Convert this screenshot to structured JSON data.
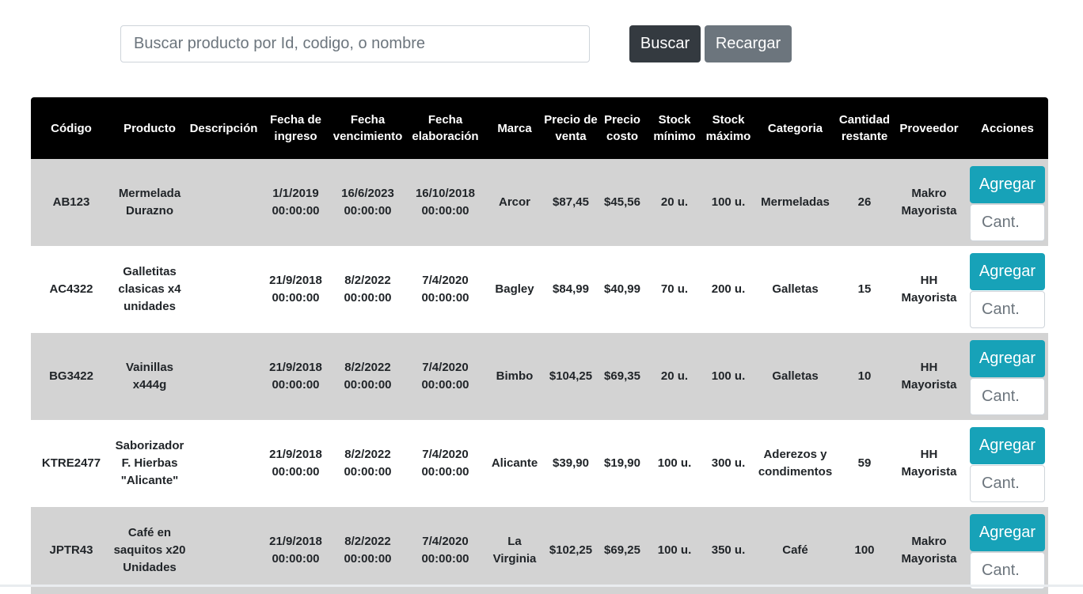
{
  "search": {
    "placeholder": "Buscar producto por Id, codigo, o nombre",
    "buscar_label": "Buscar",
    "recargar_label": "Recargar"
  },
  "table": {
    "headers": [
      "Código",
      "Producto",
      "Descripción",
      "Fecha de ingreso",
      "Fecha vencimiento",
      "Fecha elaboración",
      "Marca",
      "Precio de venta",
      "Precio costo",
      "Stock mínimo",
      "Stock máximo",
      "Categoria",
      "Cantidad restante",
      "Proveedor",
      "Acciones"
    ],
    "rows": [
      {
        "codigo": "AB123",
        "producto": "Mermelada Durazno",
        "descripcion": "",
        "ingreso": "1/1/2019 00:00:00",
        "vencimiento": "16/6/2023 00:00:00",
        "elaboracion": "16/10/2018 00:00:00",
        "marca": "Arcor",
        "precio_venta": "$87,45",
        "precio_costo": "$45,56",
        "stock_min": "20 u.",
        "stock_max": "100 u.",
        "categoria": "Mermeladas",
        "cantidad": "26",
        "proveedor": "Makro Mayorista",
        "agregar": "Agregar",
        "cant_placeholder": "Cant."
      },
      {
        "codigo": "AC4322",
        "producto": "Galletitas clasicas x4 unidades",
        "descripcion": "",
        "ingreso": "21/9/2018 00:00:00",
        "vencimiento": "8/2/2022 00:00:00",
        "elaboracion": "7/4/2020 00:00:00",
        "marca": "Bagley",
        "precio_venta": "$84,99",
        "precio_costo": "$40,99",
        "stock_min": "70 u.",
        "stock_max": "200 u.",
        "categoria": "Galletas",
        "cantidad": "15",
        "proveedor": "HH Mayorista",
        "agregar": "Agregar",
        "cant_placeholder": "Cant."
      },
      {
        "codigo": "BG3422",
        "producto": "Vainillas x444g",
        "descripcion": "",
        "ingreso": "21/9/2018 00:00:00",
        "vencimiento": "8/2/2022 00:00:00",
        "elaboracion": "7/4/2020 00:00:00",
        "marca": "Bimbo",
        "precio_venta": "$104,25",
        "precio_costo": "$69,35",
        "stock_min": "20 u.",
        "stock_max": "100 u.",
        "categoria": "Galletas",
        "cantidad": "10",
        "proveedor": "HH Mayorista",
        "agregar": "Agregar",
        "cant_placeholder": "Cant."
      },
      {
        "codigo": "KTRE2477",
        "producto": "Saborizador F. Hierbas \"Alicante\"",
        "descripcion": "",
        "ingreso": "21/9/2018 00:00:00",
        "vencimiento": "8/2/2022 00:00:00",
        "elaboracion": "7/4/2020 00:00:00",
        "marca": "Alicante",
        "precio_venta": "$39,90",
        "precio_costo": "$19,90",
        "stock_min": "100 u.",
        "stock_max": "300 u.",
        "categoria": "Aderezos y condimentos",
        "cantidad": "59",
        "proveedor": "HH Mayorista",
        "agregar": "Agregar",
        "cant_placeholder": "Cant."
      },
      {
        "codigo": "JPTR43",
        "producto": "Café en saquitos x20 Unidades",
        "descripcion": "",
        "ingreso": "21/9/2018 00:00:00",
        "vencimiento": "8/2/2022 00:00:00",
        "elaboracion": "7/4/2020 00:00:00",
        "marca": "La Virginia",
        "precio_venta": "$102,25",
        "precio_costo": "$69,25",
        "stock_min": "100 u.",
        "stock_max": "350 u.",
        "categoria": "Café",
        "cantidad": "100",
        "proveedor": "Makro Mayorista",
        "agregar": "Agregar",
        "cant_placeholder": "Cant."
      }
    ]
  },
  "colors": {
    "buscar_bg": "#343a40",
    "recargar_bg": "#6c757d",
    "agregar_bg": "#17a2b8",
    "header_bg": "#000000",
    "row_odd_bg": "#d3d3d3",
    "row_even_bg": "#ffffff"
  }
}
